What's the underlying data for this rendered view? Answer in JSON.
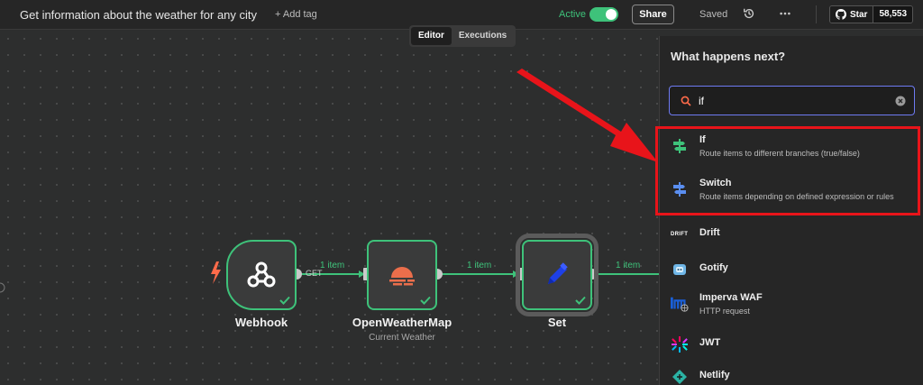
{
  "header": {
    "workflow_title": "Get information about the weather for any city",
    "add_tag": "+ Add tag",
    "active_label": "Active",
    "share_label": "Share",
    "saved_label": "Saved",
    "github_star_label": "Star",
    "github_star_count": "58,553"
  },
  "view_tabs": [
    "Editor",
    "Executions"
  ],
  "canvas": {
    "nodes": [
      {
        "label": "Webhook",
        "subtitle": ""
      },
      {
        "label": "OpenWeatherMap",
        "subtitle": "Current Weather"
      },
      {
        "label": "Set",
        "subtitle": ""
      }
    ],
    "edges": [
      {
        "label": "1 item",
        "method": "GET"
      },
      {
        "label": "1 item"
      },
      {
        "label": "1 item"
      }
    ]
  },
  "panel": {
    "title": "What happens next?",
    "search_value": "if",
    "items": [
      {
        "name": "If",
        "description": "Route items to different branches (true/false)",
        "icon": "if-branch-icon"
      },
      {
        "name": "Switch",
        "description": "Route items depending on defined expression or rules",
        "icon": "switch-icon"
      },
      {
        "name": "Drift",
        "description": "",
        "icon": "drift-logo-icon",
        "logo_text": "DRIFT"
      },
      {
        "name": "Gotify",
        "description": "",
        "icon": "gotify-icon"
      },
      {
        "name": "Imperva WAF",
        "description": "HTTP request",
        "icon": "imperva-icon"
      },
      {
        "name": "JWT",
        "description": "",
        "icon": "jwt-icon"
      },
      {
        "name": "Netlify",
        "description": "",
        "icon": "netlify-icon"
      }
    ]
  },
  "colors": {
    "accent_green": "#3ec27a",
    "highlight_red": "#e8141a",
    "search_focus": "#6e7bf2"
  }
}
